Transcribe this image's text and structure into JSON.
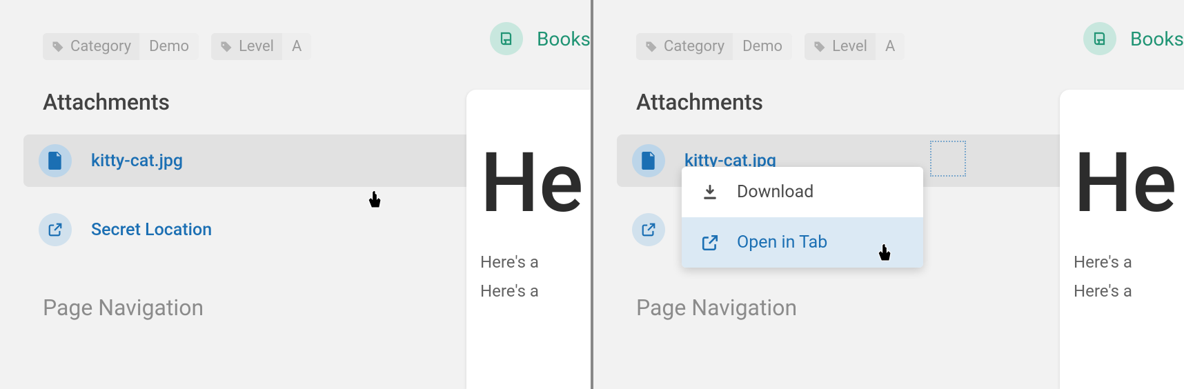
{
  "tags": [
    {
      "key": "Category",
      "value": "Demo"
    },
    {
      "key": "Level",
      "value": "A"
    }
  ],
  "sections": {
    "attachments_title": "Attachments",
    "page_nav_title": "Page Navigation"
  },
  "attachments": [
    {
      "name": "kitty-cat.jpg",
      "icon": "file"
    },
    {
      "name": "Secret Location",
      "icon": "external"
    }
  ],
  "books_link": {
    "label": "Books"
  },
  "content": {
    "heading_partial": "He",
    "line1": "Here's a",
    "line2": "Here's a"
  },
  "dropdown": {
    "items": [
      {
        "label": "Download",
        "icon": "download"
      },
      {
        "label": "Open in Tab",
        "icon": "external"
      }
    ]
  }
}
